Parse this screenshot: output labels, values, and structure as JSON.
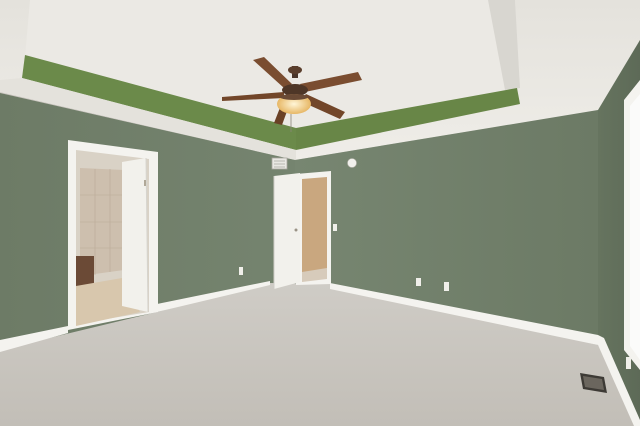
{
  "scene": {
    "description_label": "",
    "colors": {
      "wall_green": "#6f7d68",
      "wall_green_shadow": "#5f6c58",
      "tray_band": "#6b8a4a",
      "ceiling": "#e9e7e2",
      "carpet": "#c9c6c0",
      "trim": "#f4f3ef",
      "door": "#f2f1ec",
      "hall_wall": "#c9a77f",
      "bath_tile": "#cdbfae"
    },
    "icons": [
      "ceiling-fan-icon",
      "light-fixture-icon",
      "smoke-detector-icon",
      "air-vent-icon",
      "floor-register-icon",
      "outlet-icon"
    ]
  }
}
